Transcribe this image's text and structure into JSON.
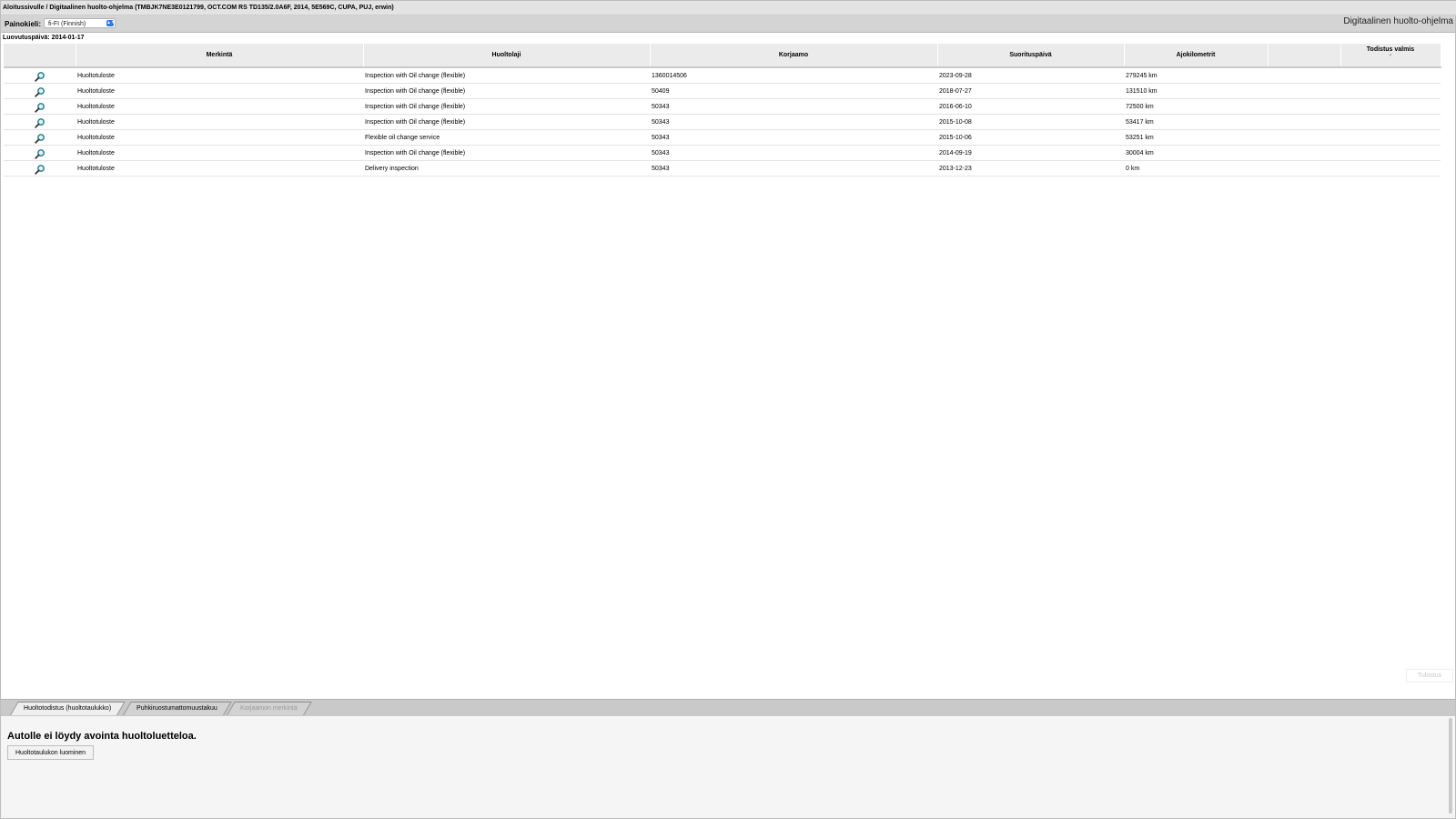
{
  "breadcrumb": "Aloitussivulle / Digitaalinen huolto-ohjelma (TMBJK7NE3E0121799, OCT.COM RS TD135/2.0A6F, 2014, 5E569C, CUPA, PUJ, erwin)",
  "toolbar": {
    "language_label": "Painokieli:",
    "language_value": "fi-FI (Finnish)",
    "app_title": "Digitaalinen huolto-ohjelma"
  },
  "delivery_date": "Luovutuspäivä: 2014-01-17",
  "table": {
    "headers": {
      "merkinta": "Merkintä",
      "huoltolaji": "Huoltolaji",
      "korjaamo": "Korjaamo",
      "suorituspaiva": "Suorituspäivä",
      "ajokilometrit": "Ajokilometrit",
      "extra": "",
      "todistus": "Todistus valmis"
    },
    "rows": [
      {
        "merkinta": "Huoltotuloste",
        "huoltolaji": "Inspection with Oil change (flexible)",
        "korjaamo": "1360014506",
        "paiva": "2023-09-28",
        "km": "279245 km"
      },
      {
        "merkinta": "Huoltotuloste",
        "huoltolaji": "Inspection with Oil change (flexible)",
        "korjaamo": "50409",
        "paiva": "2018-07-27",
        "km": "131510 km"
      },
      {
        "merkinta": "Huoltotuloste",
        "huoltolaji": "Inspection with Oil change (flexible)",
        "korjaamo": "50343",
        "paiva": "2016-06-10",
        "km": "72500 km"
      },
      {
        "merkinta": "Huoltotuloste",
        "huoltolaji": "Inspection with Oil change (flexible)",
        "korjaamo": "50343",
        "paiva": "2015-10-08",
        "km": "53417 km"
      },
      {
        "merkinta": "Huoltotuloste",
        "huoltolaji": "Flexible oil change service",
        "korjaamo": "50343",
        "paiva": "2015-10-06",
        "km": "53251 km"
      },
      {
        "merkinta": "Huoltotuloste",
        "huoltolaji": "Inspection with Oil change (flexible)",
        "korjaamo": "50343",
        "paiva": "2014-09-19",
        "km": "30004 km"
      },
      {
        "merkinta": "Huoltotuloste",
        "huoltolaji": "Delivery inspection",
        "korjaamo": "50343",
        "paiva": "2013-12-23",
        "km": "0 km"
      }
    ]
  },
  "print_button": "Tulostus",
  "tabs": [
    {
      "label": "Huoltotodistus (huoltotaulukko)",
      "state": "active"
    },
    {
      "label": "Puhkiruostumattomuustakuu",
      "state": "normal"
    },
    {
      "label": "Korjaamon merkintä",
      "state": "disabled"
    }
  ],
  "bottom": {
    "message": "Autolle ei löydy avointa huoltoluetteloa.",
    "create_button": "Huoltotaulukon luominen"
  },
  "icons": {
    "row_icon": "magnifier-icon",
    "select_arrow": "chevron-updown-icon"
  },
  "colors": {
    "accent": "#2f7ae0",
    "magnifier": "#1a7a8a"
  }
}
